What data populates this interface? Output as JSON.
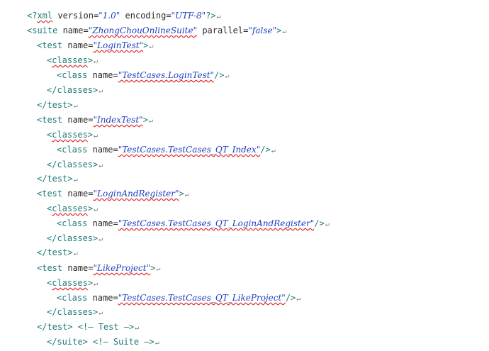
{
  "lines": [
    {
      "id": "l1",
      "parts": [
        {
          "t": "<?",
          "c": "tag"
        },
        {
          "t": "xml",
          "c": "tag ul"
        },
        {
          "t": " version=",
          "c": "kw"
        },
        {
          "t": "\"1.0\"",
          "c": "plain"
        },
        {
          "t": " encoding=",
          "c": "kw"
        },
        {
          "t": "\"UTF-8\"",
          "c": "plain"
        },
        {
          "t": "?>",
          "c": "tag"
        }
      ]
    },
    {
      "id": "l2",
      "parts": [
        {
          "t": "<suite",
          "c": "tag"
        },
        {
          "t": " name=",
          "c": "kw"
        },
        {
          "t": "\"ZhongChouOnlineSuite\"",
          "c": "val"
        },
        {
          "t": " parallel=",
          "c": "kw"
        },
        {
          "t": "\"false\"",
          "c": "plain"
        },
        {
          "t": ">",
          "c": "tag"
        }
      ]
    },
    {
      "id": "l3",
      "parts": [
        {
          "t": "<test",
          "c": "tag"
        },
        {
          "t": " name=",
          "c": "kw"
        },
        {
          "t": "\"LoginTest\"",
          "c": "val"
        },
        {
          "t": ">",
          "c": "tag"
        }
      ]
    },
    {
      "id": "l4",
      "parts": [
        {
          "t": "<",
          "c": "tag"
        },
        {
          "t": "classes",
          "c": "tag ul"
        },
        {
          "t": ">",
          "c": "tag"
        }
      ]
    },
    {
      "id": "l5",
      "parts": [
        {
          "t": "<class",
          "c": "tag"
        },
        {
          "t": " name=",
          "c": "kw"
        },
        {
          "t": "\"TestCases.LoginTest\"",
          "c": "val"
        },
        {
          "t": "/>",
          "c": "tag"
        }
      ]
    },
    {
      "id": "l6",
      "parts": [
        {
          "t": "</classes>",
          "c": "tag"
        }
      ]
    },
    {
      "id": "l7",
      "parts": [
        {
          "t": "</test>",
          "c": "tag"
        }
      ]
    },
    {
      "id": "l8",
      "parts": [
        {
          "t": "<test",
          "c": "tag"
        },
        {
          "t": " name=",
          "c": "kw"
        },
        {
          "t": "\"IndexTest\"",
          "c": "val"
        },
        {
          "t": ">",
          "c": "tag"
        }
      ]
    },
    {
      "id": "l9",
      "parts": [
        {
          "t": "<",
          "c": "tag"
        },
        {
          "t": "classes",
          "c": "tag ul"
        },
        {
          "t": ">",
          "c": "tag"
        }
      ]
    },
    {
      "id": "l10",
      "parts": [
        {
          "t": "<class",
          "c": "tag"
        },
        {
          "t": " name=",
          "c": "kw"
        },
        {
          "t": "\"TestCases.TestCases_QT_Index\"",
          "c": "val"
        },
        {
          "t": "/>",
          "c": "tag"
        }
      ]
    },
    {
      "id": "l11",
      "parts": [
        {
          "t": "</classes>",
          "c": "tag"
        }
      ]
    },
    {
      "id": "l12",
      "parts": [
        {
          "t": "</test>",
          "c": "tag"
        }
      ]
    },
    {
      "id": "l13",
      "parts": [
        {
          "t": "<test",
          "c": "tag"
        },
        {
          "t": " name=",
          "c": "kw"
        },
        {
          "t": "\"LoginAndRegister\"",
          "c": "val"
        },
        {
          "t": ">",
          "c": "tag"
        }
      ]
    },
    {
      "id": "l14",
      "parts": [
        {
          "t": "<",
          "c": "tag"
        },
        {
          "t": "classes",
          "c": "tag ul"
        },
        {
          "t": ">",
          "c": "tag"
        }
      ]
    },
    {
      "id": "l15",
      "parts": [
        {
          "t": "<class",
          "c": "tag"
        },
        {
          "t": " name=",
          "c": "kw"
        },
        {
          "t": "\"TestCases.TestCases_QT_LoginAndRegister\"",
          "c": "val"
        },
        {
          "t": "/>",
          "c": "tag"
        }
      ]
    },
    {
      "id": "l16",
      "parts": [
        {
          "t": "</classes>",
          "c": "tag"
        }
      ]
    },
    {
      "id": "l17",
      "parts": [
        {
          "t": "</test>",
          "c": "tag"
        }
      ]
    },
    {
      "id": "l18",
      "parts": [
        {
          "t": "<test",
          "c": "tag"
        },
        {
          "t": " name=",
          "c": "kw"
        },
        {
          "t": "\"LikeProject\"",
          "c": "val"
        },
        {
          "t": ">",
          "c": "tag"
        }
      ]
    },
    {
      "id": "l19",
      "parts": [
        {
          "t": "<",
          "c": "tag"
        },
        {
          "t": "classes",
          "c": "tag ul"
        },
        {
          "t": ">",
          "c": "tag"
        }
      ]
    },
    {
      "id": "l20",
      "parts": [
        {
          "t": "<class",
          "c": "tag"
        },
        {
          "t": " name=",
          "c": "kw"
        },
        {
          "t": "\"TestCases.TestCases_QT_LikeProject\"",
          "c": "val"
        },
        {
          "t": "/>",
          "c": "tag"
        }
      ]
    },
    {
      "id": "l21",
      "parts": [
        {
          "t": "</classes>",
          "c": "tag"
        }
      ]
    },
    {
      "id": "l22",
      "parts": [
        {
          "t": "</test> ",
          "c": "tag"
        },
        {
          "t": "<!— Test —>",
          "c": "cmt"
        }
      ]
    },
    {
      "id": "l23",
      "parts": [
        {
          "t": "</suite> ",
          "c": "tag"
        },
        {
          "t": "<!— Suite —>",
          "c": "cmt"
        }
      ]
    }
  ],
  "return_glyph": "↵"
}
